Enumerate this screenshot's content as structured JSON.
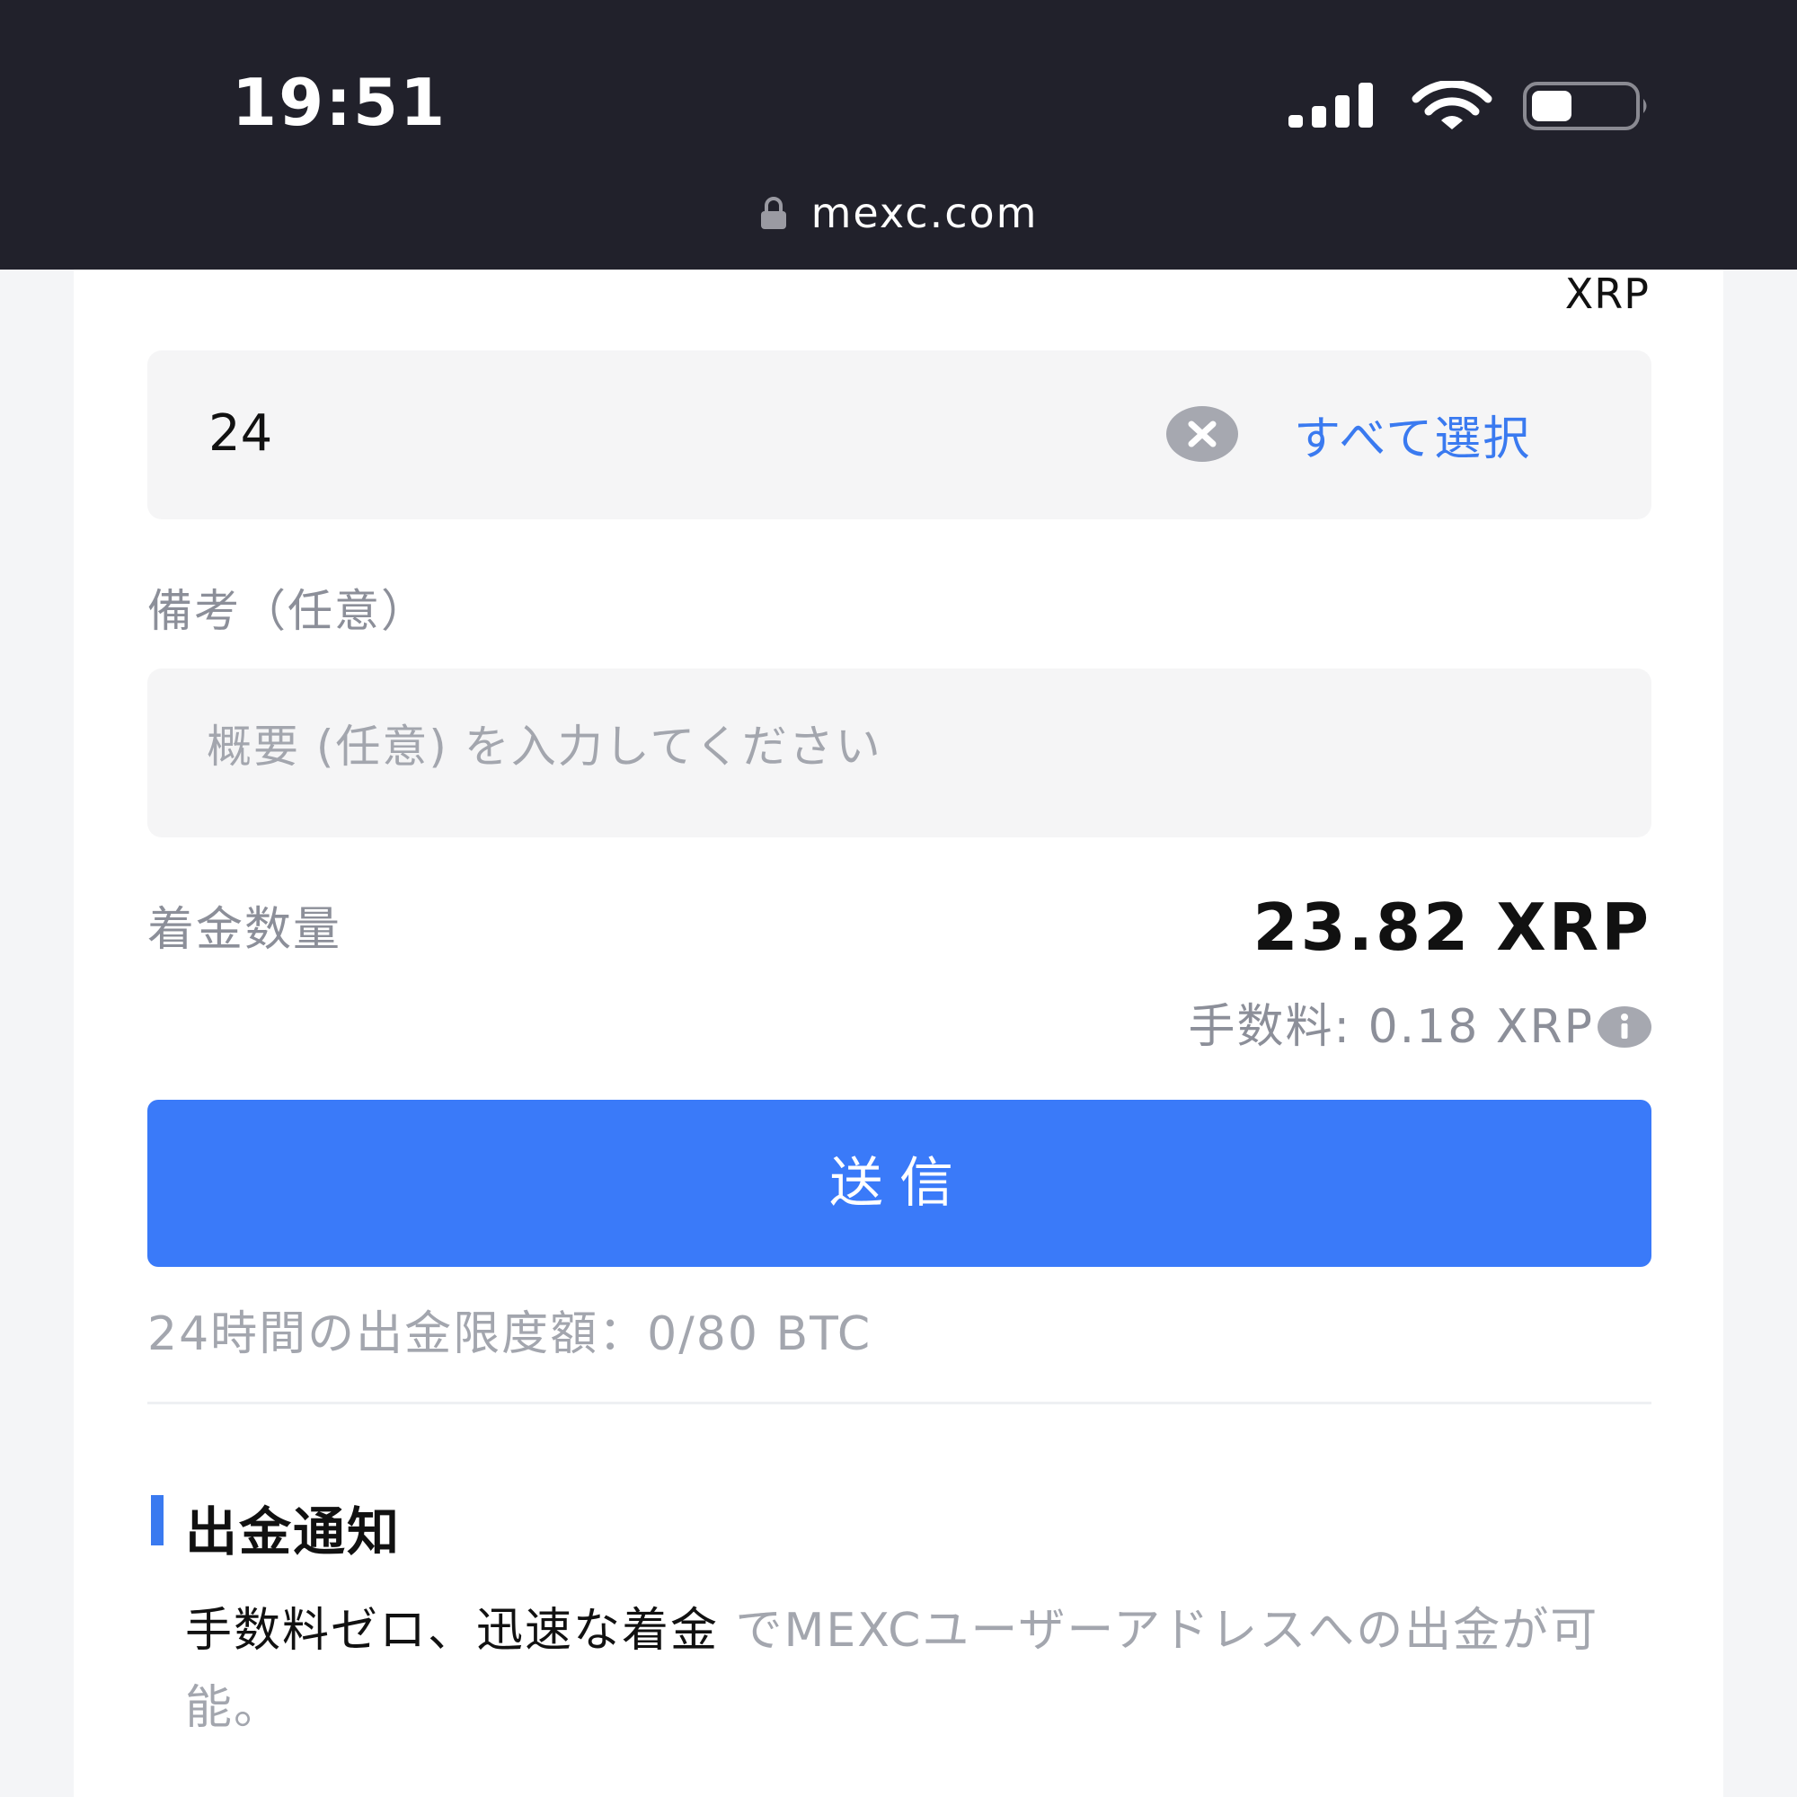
{
  "status_bar": {
    "time": "19:51",
    "icons": [
      "signal-icon",
      "wifi-icon",
      "battery-icon"
    ]
  },
  "browser": {
    "url": "mexc.com",
    "lock_icon": "lock-icon"
  },
  "withdraw_form": {
    "unit": "XRP",
    "amount": {
      "value": "24",
      "clear_icon": "clear-icon",
      "select_all_label": "すべて選択"
    },
    "memo": {
      "label": "備考（任意）",
      "placeholder": "概要 (任意) を入力してください"
    },
    "receive": {
      "label": "着金数量",
      "value": "23.82 XRP",
      "fee_label": "手数料: 0.18 XRP",
      "info_icon": "info-icon"
    },
    "send_button_label": "送信",
    "daily_limit": "24時間の出金限度額：0/80 BTC"
  },
  "notice": {
    "title": "出金通知",
    "body_highlight": "手数料ゼロ、迅速な着金",
    "body_rest": " でMEXCユーザーアドレスへの出金が可能。"
  },
  "colors": {
    "accent": "#3a7af9",
    "link": "#3a7af0",
    "status_bar_bg": "#21212b",
    "muted_text": "#8c8f99",
    "field_bg": "#f5f5f6"
  }
}
